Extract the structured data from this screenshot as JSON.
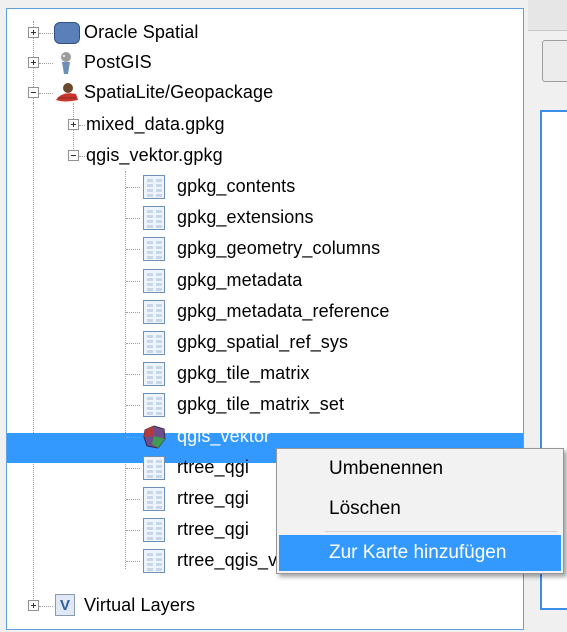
{
  "tree": {
    "items": [
      {
        "label": "Oracle Spatial",
        "icon": "oracle-spatial-icon"
      },
      {
        "label": "PostGIS",
        "icon": "postgis-icon"
      },
      {
        "label": "SpatiaLite/Geopackage",
        "icon": "spatialite-icon"
      },
      {
        "label": "mixed_data.gpkg"
      },
      {
        "label": "qgis_vektor.gpkg"
      },
      {
        "label": "gpkg_contents",
        "icon": "table-icon"
      },
      {
        "label": "gpkg_extensions",
        "icon": "table-icon"
      },
      {
        "label": "gpkg_geometry_columns",
        "icon": "table-icon"
      },
      {
        "label": "gpkg_metadata",
        "icon": "table-icon"
      },
      {
        "label": "gpkg_metadata_reference",
        "icon": "table-icon"
      },
      {
        "label": "gpkg_spatial_ref_sys",
        "icon": "table-icon"
      },
      {
        "label": "gpkg_tile_matrix",
        "icon": "table-icon"
      },
      {
        "label": "gpkg_tile_matrix_set",
        "icon": "table-icon"
      },
      {
        "label": "qgis_vektor",
        "icon": "polygon-layer-icon",
        "selected": true
      },
      {
        "label": "rtree_qgi",
        "icon": "table-icon"
      },
      {
        "label": "rtree_qgi",
        "icon": "table-icon"
      },
      {
        "label": "rtree_qgi",
        "icon": "table-icon"
      },
      {
        "label": "rtree_qgis_vektor_geometry_r",
        "icon": "table-icon"
      },
      {
        "label": "Virtual Layers",
        "icon": "virtual-layers-icon"
      }
    ]
  },
  "context_menu": {
    "items": [
      {
        "label": "Umbenennen"
      },
      {
        "label": "Löschen"
      },
      {
        "label": "Zur Karte hinzufügen",
        "active": true
      }
    ]
  },
  "colors": {
    "selection": "#3399ff",
    "panel_border": "#5ea0e0"
  }
}
